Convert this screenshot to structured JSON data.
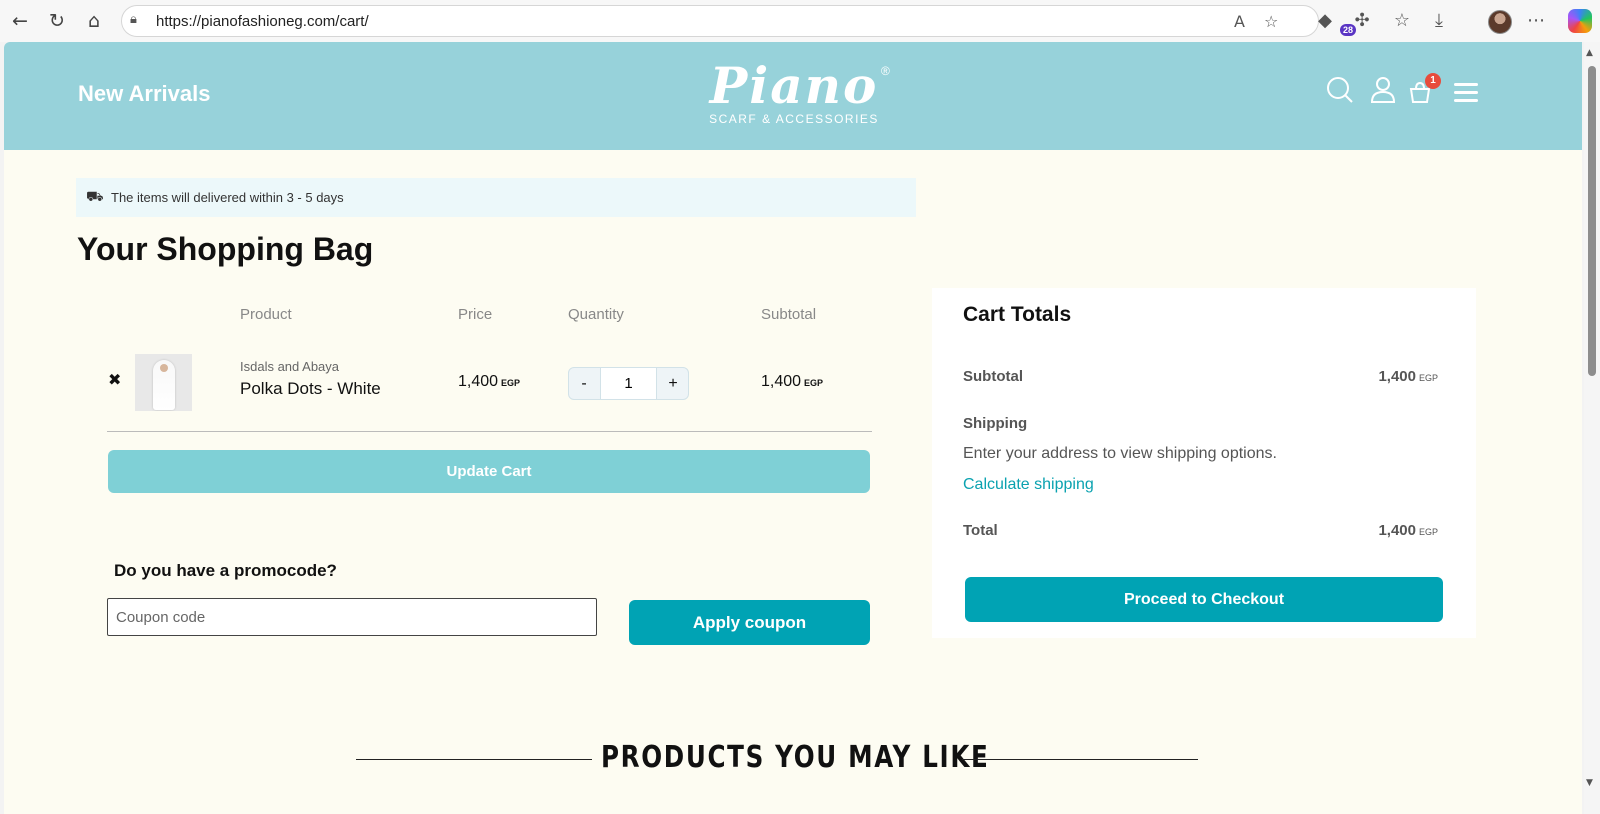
{
  "browser": {
    "url": "https://pianofashioneg.com/cart/",
    "extension_badge": "28"
  },
  "header": {
    "new_arrivals": "New Arrivals",
    "logo_word": "Piano",
    "logo_reg": "®",
    "logo_tagline": "SCARF & ACCESSORIES",
    "cart_count": "1"
  },
  "notice": {
    "delivery_text": "The items will delivered within 3 - 5 days"
  },
  "cart": {
    "title": "Your Shopping Bag",
    "columns": [
      "Product",
      "Price",
      "Quantity",
      "Subtotal"
    ],
    "items": [
      {
        "category": "Isdals and Abaya",
        "name": "Polka Dots - White",
        "price": "1,400",
        "currency": "EGP",
        "quantity": "1",
        "subtotal": "1,400"
      }
    ],
    "qty_minus": "-",
    "qty_plus": "+",
    "remove_symbol": "✖",
    "update_label": "Update Cart",
    "promo_title": "Do you have a promocode?",
    "coupon_placeholder": "Coupon code",
    "apply_label": "Apply coupon"
  },
  "totals": {
    "title": "Cart Totals",
    "subtotal_label": "Subtotal",
    "subtotal_value": "1,400",
    "currency": "EGP",
    "shipping_label": "Shipping",
    "shipping_note": "Enter your address to view shipping options.",
    "calc_shipping": "Calculate shipping",
    "total_label": "Total",
    "total_value": "1,400",
    "checkout_label": "Proceed to Checkout"
  },
  "recommendations": {
    "title": "PRODUCTS YOU MAY LIKE"
  }
}
